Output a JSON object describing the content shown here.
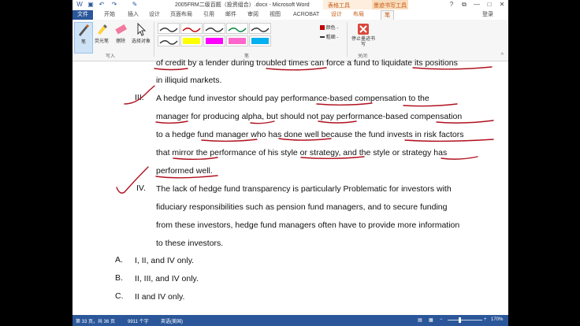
{
  "titlebar": {
    "title": "2005FRM二级百题（投资组合）.docx - Microsoft Word",
    "window_controls": [
      "?",
      "⧉",
      "—",
      "□",
      "✕"
    ]
  },
  "tabs": {
    "file": "文件",
    "items": [
      "开始",
      "插入",
      "设计",
      "页面布局",
      "引用",
      "邮件",
      "审阅",
      "视图",
      "ACROBAT"
    ],
    "context_group_table": "表格工具",
    "context_group_ink": "墨迹书写工具",
    "context_tabs": [
      "设计",
      "布局"
    ],
    "active": "笔",
    "login": "登录"
  },
  "ribbon": {
    "write_tools": [
      "笔",
      "荧光笔",
      "擦除",
      "选择对象"
    ],
    "write_group": "写入",
    "pens_group": "笔",
    "color_label": "颜色 -",
    "thickness_label": "粗细 -",
    "stop_label": "停止墨迹书写",
    "close_group": "关闭",
    "pen_colors": [
      "#333333",
      "#c00000",
      "#333333",
      "#00843d",
      "#333333",
      "#333333",
      "#ffff00",
      "#ff00ff",
      "#ff66cc",
      "#00b0f0"
    ]
  },
  "document": {
    "lines": [
      "of credit by a lender during troubled times can force a fund to liquidate its positions",
      "in illiquid markets.",
      "A hedge fund investor should pay performance-based compensation to the",
      "manager for producing alpha, but should not pay performance-based compensation",
      "to a hedge fund manager who has done well because the fund invests in risk factors",
      "that mirror the performance of his style or strategy, and the style or strategy has",
      "performed well.",
      "The lack of hedge fund transparency is particularly Problematic for investors with",
      "fiduciary responsibilities such as pension fund managers, and to secure funding",
      "from these investors, hedge fund managers often have to provide more information",
      "to these investors."
    ],
    "roman": [
      "III.",
      "IV."
    ],
    "options": [
      {
        "letter": "A.",
        "text": "I, II, and IV only."
      },
      {
        "letter": "B.",
        "text": "II, III, and IV only."
      },
      {
        "letter": "C.",
        "text": "II and IV only."
      }
    ]
  },
  "statusbar": {
    "page": "第 33 页，共 36 页",
    "words": "9911 个字",
    "language": "英语(美国)",
    "zoom": "170%"
  }
}
